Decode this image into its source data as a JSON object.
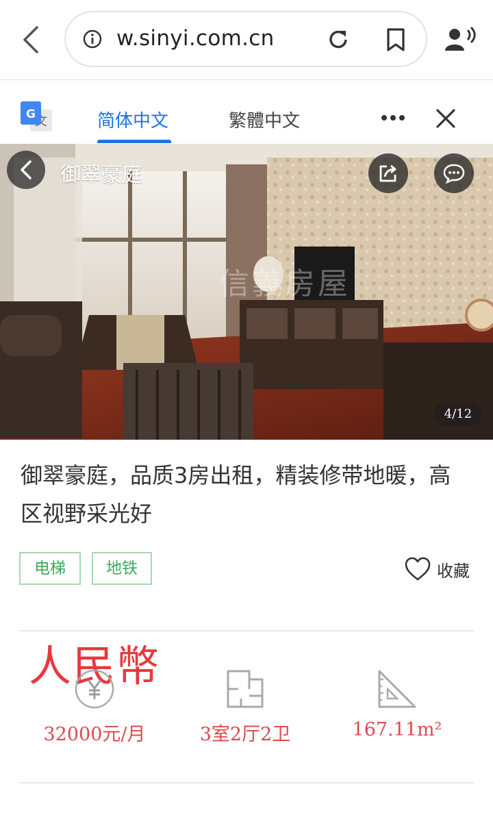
{
  "browser": {
    "url": "w.sinyi.com.cn"
  },
  "translate_bar": {
    "active_tab": "简体中文",
    "inactive_tab": "繁體中文",
    "logo_glyph": "文",
    "logo_letter": "G"
  },
  "photo": {
    "title": "御翠豪庭",
    "counter": "4/12",
    "watermark": "信義房屋"
  },
  "listing": {
    "title": "御翠豪庭，品质3房出租，精装修带地暖，高区视野采光好",
    "tags": [
      "电梯",
      "地铁"
    ],
    "favorite_label": "收藏",
    "annotation": "人民幣",
    "stats": {
      "price": "32000元/月",
      "layout": "3室2厅2卫",
      "area": "167.11m²"
    }
  },
  "colors": {
    "accent_blue": "#1a73e8",
    "tag_green": "#3aaa5a",
    "price_red": "#e0484c",
    "annotation_red": "#e8383d"
  },
  "icons": {
    "back": "chevron-left-icon",
    "info": "info-icon",
    "reload": "reload-icon",
    "bookmark": "bookmark-icon",
    "voice": "voice-icon",
    "more": "more-icon",
    "close": "close-icon",
    "share": "share-icon",
    "chat": "chat-icon",
    "heart": "heart-icon",
    "price": "yuan-icon",
    "floorplan": "floorplan-icon",
    "area": "ruler-icon"
  }
}
